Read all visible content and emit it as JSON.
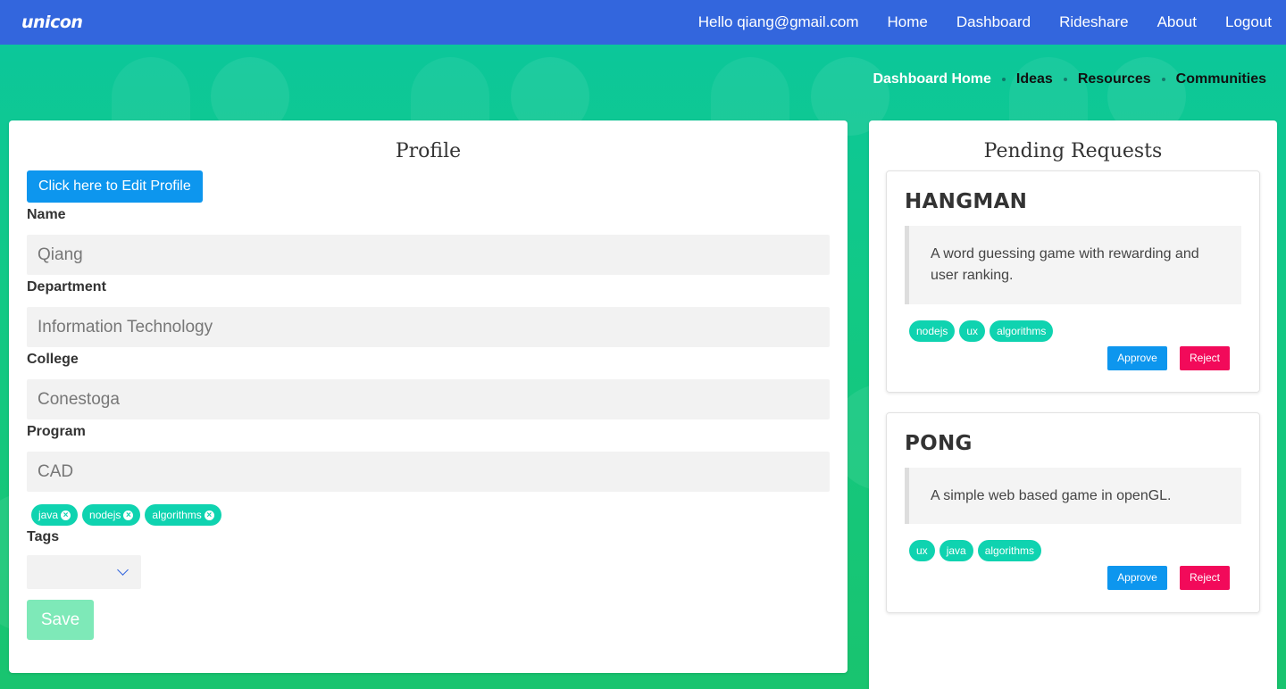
{
  "navbar": {
    "brand": "unicon",
    "links": [
      "Hello qiang@gmail.com",
      "Home",
      "Dashboard",
      "Rideshare",
      "About",
      "Logout"
    ]
  },
  "subnav": {
    "items": [
      "Dashboard Home",
      "Ideas",
      "Resources",
      "Communities"
    ],
    "active": "Dashboard Home"
  },
  "profile": {
    "title": "Profile",
    "edit_button": "Click here to Edit Profile",
    "fields": [
      {
        "label": "Name",
        "value": "Qiang"
      },
      {
        "label": "Department",
        "value": "Information Technology"
      },
      {
        "label": "College",
        "value": "Conestoga"
      },
      {
        "label": "Program",
        "value": "CAD"
      }
    ],
    "selected_tags": [
      "java",
      "nodejs",
      "algorithms"
    ],
    "tags_label": "Tags",
    "tags_select_value": "",
    "save_button": "Save"
  },
  "pending": {
    "title": "Pending Requests",
    "requests": [
      {
        "name": "HANGMAN",
        "description": "A word guessing game with rewarding and user ranking.",
        "tags": [
          "nodejs",
          "ux",
          "algorithms"
        ],
        "approve": "Approve",
        "reject": "Reject"
      },
      {
        "name": "PONG",
        "description": "A simple web based game in openGL.",
        "tags": [
          "ux",
          "java",
          "algorithms"
        ],
        "approve": "Approve",
        "reject": "Reject"
      }
    ]
  },
  "colors": {
    "navbar": "#3366dd",
    "tag": "#0fd3b0",
    "primary_button": "#0d96ee",
    "reject_button": "#f20a5a",
    "save_button": "#7ee9b8"
  }
}
